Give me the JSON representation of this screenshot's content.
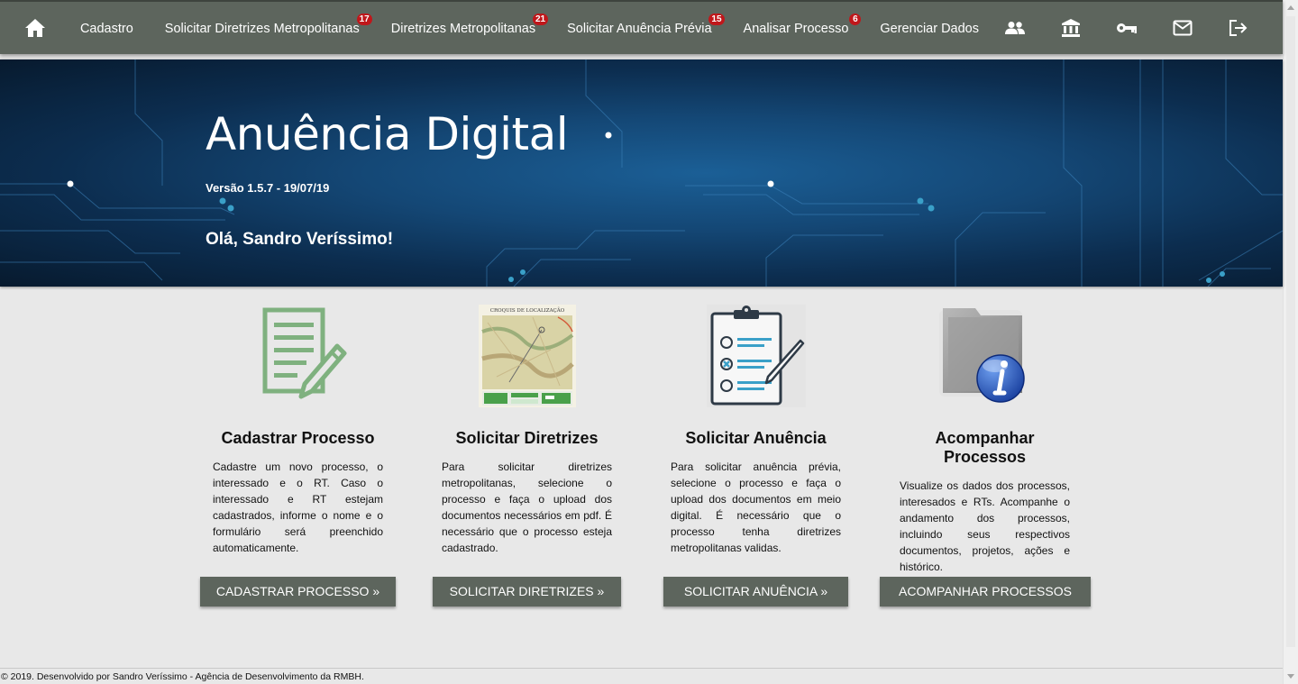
{
  "nav": {
    "items": [
      {
        "label": "Cadastro",
        "badge": null
      },
      {
        "label": "Solicitar Diretrizes Metropolitanas",
        "badge": "17"
      },
      {
        "label": "Diretrizes Metropolitanas",
        "badge": "21"
      },
      {
        "label": "Solicitar Anuência Prévia",
        "badge": "15"
      },
      {
        "label": "Analisar Processo",
        "badge": "6"
      },
      {
        "label": "Gerenciar Dados",
        "badge": null
      }
    ],
    "icons": [
      "users-icon",
      "bank-icon",
      "key-icon",
      "mail-icon",
      "logout-icon"
    ]
  },
  "hero": {
    "title": "Anuência Digital",
    "version": "Versão 1.5.7 - 19/07/19",
    "greeting": "Olá, Sandro Veríssimo!"
  },
  "cards": [
    {
      "title": "Cadastrar Processo",
      "text": "Cadastre um novo processo, o interessado e o RT. Caso o interessado e RT estejam cadastrados, informe o nome e o formulário será preenchido automaticamente.",
      "button": "CADASTRAR PROCESSO »",
      "icon": "document-edit-icon"
    },
    {
      "title": "Solicitar Diretrizes",
      "text": "Para solicitar diretrizes metropolitanas, selecione o processo e faça o upload dos documentos necessários em pdf. É necessário que o processo esteja cadastrado.",
      "button": "SOLICITAR DIRETRIZES »",
      "icon": "map-croquis-icon",
      "image_caption": "CROQUIS DE LOCALIZAÇÃO"
    },
    {
      "title": "Solicitar Anuência",
      "text": "Para solicitar anuência prévia, selecione o processo e faça o upload dos documentos em meio digital. É necessário que o processo tenha diretrizes metropolitanas validas.",
      "button": "SOLICITAR ANUÊNCIA »",
      "icon": "clipboard-checklist-icon"
    },
    {
      "title": "Acompanhar Processos",
      "text": "Visualize os dados dos processos, interesados e RTs. Acompanhe o andamento dos processos, incluindo seus respectivos documentos, projetos, ações e histórico.",
      "button": "ACOMPANHAR PROCESSOS",
      "icon": "folder-info-icon"
    }
  ],
  "footer": {
    "text": "© 2019. Desenvolvido por Sandro Veríssimo - Agência de Desenvolvimento da RMBH."
  },
  "colors": {
    "navbar": "#5d655d",
    "badge": "#c0171b",
    "button": "#5d655d",
    "hero_dark": "#0c2d4f",
    "icon_green": "#7fb17f",
    "icon_blue": "#3aa0c8"
  }
}
